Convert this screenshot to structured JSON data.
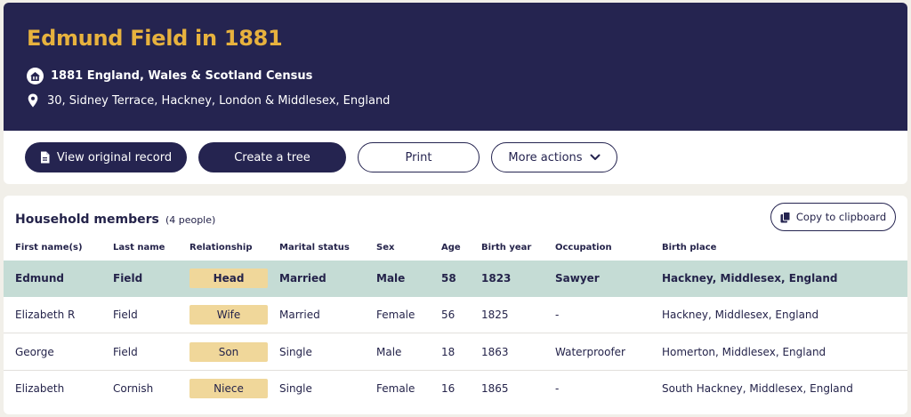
{
  "header": {
    "title": "Edmund Field in 1881",
    "census": "1881 England, Wales & Scotland Census",
    "address": "30, Sidney Terrace, Hackney, London & Middlesex, England"
  },
  "actions": {
    "view_original": "View original record",
    "create_tree": "Create a tree",
    "print": "Print",
    "more_actions": "More actions"
  },
  "household": {
    "title": "Household members",
    "count": "(4 people)",
    "copy_label": "Copy to clipboard",
    "columns": [
      "First name(s)",
      "Last name",
      "Relationship",
      "Marital status",
      "Sex",
      "Age",
      "Birth year",
      "Occupation",
      "Birth place"
    ],
    "rows": [
      {
        "first": "Edmund",
        "last": "Field",
        "relationship": "Head",
        "marital": "Married",
        "sex": "Male",
        "age": "58",
        "birth_year": "1823",
        "occupation": "Sawyer",
        "birth_place": "Hackney, Middlesex, England"
      },
      {
        "first": "Elizabeth R",
        "last": "Field",
        "relationship": "Wife",
        "marital": "Married",
        "sex": "Female",
        "age": "56",
        "birth_year": "1825",
        "occupation": "-",
        "birth_place": "Hackney, Middlesex, England"
      },
      {
        "first": "George",
        "last": "Field",
        "relationship": "Son",
        "marital": "Single",
        "sex": "Male",
        "age": "18",
        "birth_year": "1863",
        "occupation": "Waterproofer",
        "birth_place": "Homerton, Middlesex, England"
      },
      {
        "first": "Elizabeth",
        "last": "Cornish",
        "relationship": "Niece",
        "marital": "Single",
        "sex": "Female",
        "age": "16",
        "birth_year": "1865",
        "occupation": "-",
        "birth_place": "South Hackney, Middlesex, England"
      }
    ]
  },
  "colors": {
    "navy": "#252450",
    "gold": "#e7b23e",
    "highlight_row": "#c5dcd5",
    "badge": "#f0d79a"
  },
  "icons": {
    "census": "house-icon",
    "address": "location-pin-icon",
    "view_original": "document-icon",
    "more_actions": "chevron-down-icon",
    "copy": "copy-icon"
  }
}
